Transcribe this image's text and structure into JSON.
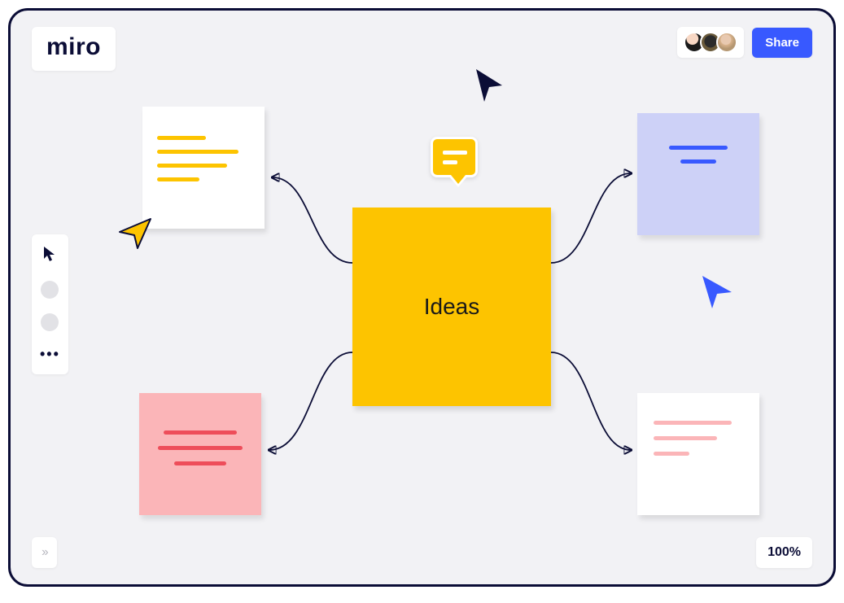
{
  "app": {
    "logo": "miro"
  },
  "header": {
    "share_label": "Share",
    "collaborators_count": 3
  },
  "toolbar": {
    "cursor_tool": "select-cursor",
    "more_glyph": "•••"
  },
  "footer": {
    "expand_glyph": "››",
    "zoom_label": "100%"
  },
  "canvas": {
    "center_note_text": "Ideas",
    "comment_icon": "comment-icon",
    "cursors": {
      "dark": "collaborator-cursor-dark",
      "yellow": "collaborator-cursor-yellow",
      "blue": "collaborator-cursor-blue"
    },
    "notes": {
      "top_left": {
        "color": "#ffffff",
        "accent": "#fdc400"
      },
      "top_right": {
        "color": "#cdd1f7",
        "accent": "#3859ff"
      },
      "bottom_left": {
        "color": "#fbb5b8",
        "accent": "#ee4d5a"
      },
      "bottom_right": {
        "color": "#ffffff",
        "accent": "#fbb5b8"
      }
    },
    "colors": {
      "brand_yellow": "#fdc400",
      "brand_blue": "#3859ff",
      "brand_navy": "#0b0d36"
    }
  }
}
